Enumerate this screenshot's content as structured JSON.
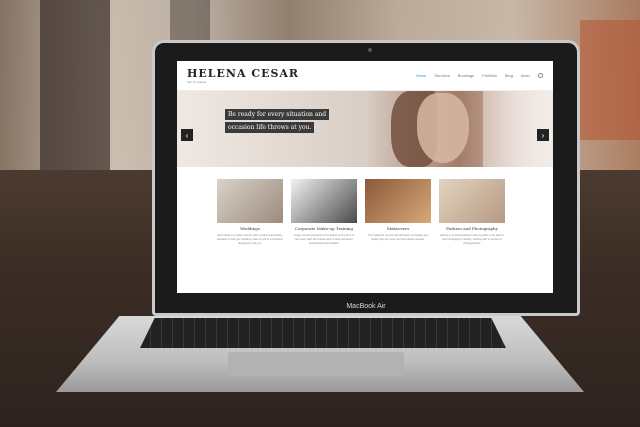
{
  "laptop": {
    "model_label": "MacBook Air"
  },
  "site": {
    "logo": "HELENA CESAR",
    "logo_sub": "hair & makeup",
    "nav": [
      "Home",
      "Services",
      "Bookings",
      "Portfolio",
      "Blog",
      "Inner"
    ],
    "hero": {
      "line1": "Be ready for every situation and",
      "line2": "occasion life throws at you.",
      "prev": "‹",
      "next": "›"
    },
    "cards": [
      {
        "title": "Weddings",
        "text": "Each bride is a unique woman with a distinct personality, because of that your wedding make up will be exclusively designed to suit you."
      },
      {
        "title": "Corporate Make-up Training",
        "text": "Image courses prepared to the beauty & true form of your team staff; all courses want to look competent, professional and beautiful."
      },
      {
        "title": "Makeovers",
        "text": "The makeover service that will leave you feeling and looking the very best you have always wanted."
      },
      {
        "title": "Fashion and Photography",
        "text": "Helena is an accomplished make-up artist in the fashion and photography industry, working with a number of photographers."
      }
    ]
  },
  "colors": {
    "nav_active": "#2d9ad3"
  }
}
